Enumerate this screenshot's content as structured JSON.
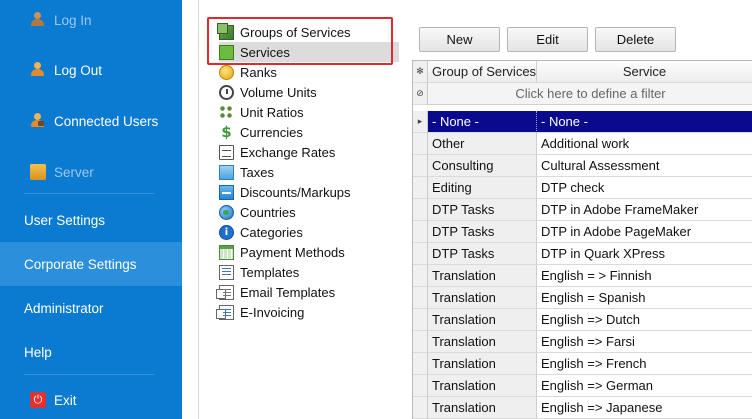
{
  "sidebar": {
    "items": [
      {
        "label": "Log In",
        "icon": "user-icon",
        "state": "disabled"
      },
      {
        "label": "Log Out",
        "icon": "user-icon",
        "state": "normal"
      },
      {
        "label": "Connected Users",
        "icon": "users-icon",
        "state": "normal"
      },
      {
        "label": "Server",
        "icon": "server-icon",
        "state": "disabled"
      },
      {
        "label": "User Settings",
        "state": "normal"
      },
      {
        "label": "Corporate Settings",
        "state": "active"
      },
      {
        "label": "Administrator",
        "state": "normal"
      },
      {
        "label": "Help",
        "state": "normal"
      },
      {
        "label": "Exit",
        "icon": "exit-icon",
        "state": "normal"
      }
    ],
    "colors": {
      "background": "#0b7ad1",
      "active": "#2b8fdc"
    }
  },
  "tree": {
    "selected": "Services",
    "items": [
      {
        "label": "Groups of Services",
        "icon": "groups-icon"
      },
      {
        "label": "Services",
        "icon": "services-icon"
      },
      {
        "label": "Ranks",
        "icon": "ranks-icon"
      },
      {
        "label": "Volume Units",
        "icon": "volume-units-icon"
      },
      {
        "label": "Unit Ratios",
        "icon": "unit-ratios-icon"
      },
      {
        "label": "Currencies",
        "icon": "currency-icon"
      },
      {
        "label": "Exchange Rates",
        "icon": "exchange-rates-icon"
      },
      {
        "label": "Taxes",
        "icon": "taxes-icon"
      },
      {
        "label": "Discounts/Markups",
        "icon": "discounts-icon"
      },
      {
        "label": "Countries",
        "icon": "globe-icon"
      },
      {
        "label": "Categories",
        "icon": "info-icon"
      },
      {
        "label": "Payment Methods",
        "icon": "payment-methods-icon"
      },
      {
        "label": "Templates",
        "icon": "templates-icon"
      },
      {
        "label": "Email Templates",
        "icon": "email-templates-icon"
      },
      {
        "label": "E-Invoicing",
        "icon": "e-invoicing-icon"
      }
    ],
    "currency_glyph": "$",
    "highlight_color": "#e0282e"
  },
  "toolbar": {
    "new_label": "New",
    "edit_label": "Edit",
    "delete_label": "Delete"
  },
  "grid": {
    "columns": [
      "Group of Services",
      "Service"
    ],
    "corner_glyph": "✻",
    "filter_glyph": "⊘",
    "current_row_glyph": "▸",
    "filter_placeholder": "Click here to define a filter",
    "selected_color": "#0a0a8e",
    "rows": [
      {
        "group": "- None -",
        "service": "- None -",
        "selected": true
      },
      {
        "group": "Other",
        "service": "Additional work"
      },
      {
        "group": "Consulting",
        "service": "Cultural Assessment"
      },
      {
        "group": "Editing",
        "service": "DTP check"
      },
      {
        "group": "DTP Tasks",
        "service": "DTP in Adobe FrameMaker"
      },
      {
        "group": "DTP Tasks",
        "service": "DTP in Adobe PageMaker"
      },
      {
        "group": "DTP Tasks",
        "service": "DTP in Quark XPress"
      },
      {
        "group": "Translation",
        "service": "English = > Finnish"
      },
      {
        "group": "Translation",
        "service": "English = Spanish"
      },
      {
        "group": "Translation",
        "service": "English => Dutch"
      },
      {
        "group": "Translation",
        "service": "English => Farsi"
      },
      {
        "group": "Translation",
        "service": "English => French"
      },
      {
        "group": "Translation",
        "service": "English => German"
      },
      {
        "group": "Translation",
        "service": "English => Japanese"
      }
    ]
  }
}
